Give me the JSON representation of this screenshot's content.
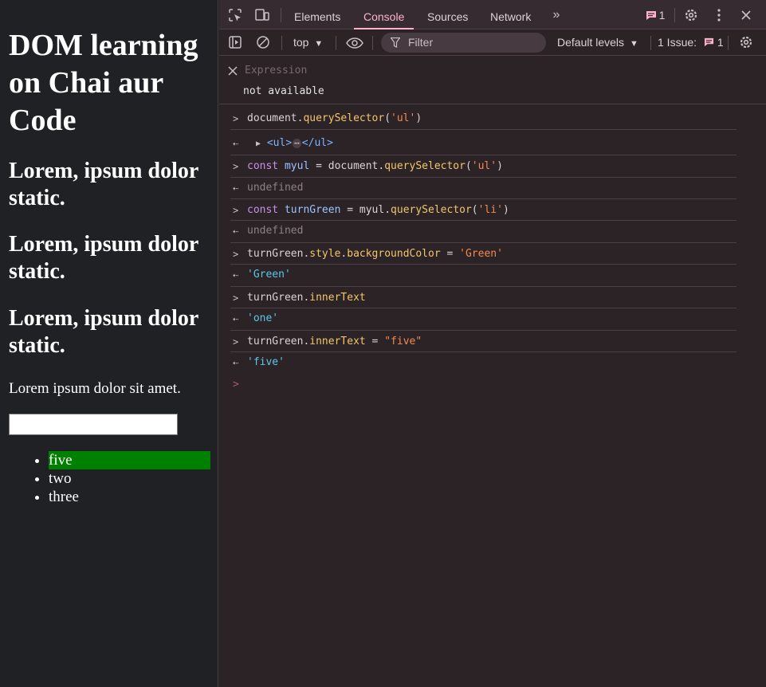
{
  "page": {
    "heading": "DOM learning on Chai aur Code",
    "subheadings": [
      "Lorem, ipsum dolor static.",
      "Lorem, ipsum dolor static.",
      "Lorem, ipsum dolor static."
    ],
    "paragraph": "Lorem ipsum dolor sit amet.",
    "list_items": [
      "five",
      "two",
      "three"
    ],
    "highlight_color": "#008000"
  },
  "devtools": {
    "tabs": [
      "Elements",
      "Console",
      "Sources",
      "Network"
    ],
    "active_tab": "Console",
    "message_count": "1",
    "context": "top",
    "filter_placeholder": "Filter",
    "levels": "Default levels",
    "issues_label": "1 Issue:",
    "issues_count": "1",
    "expression_label": "Expression",
    "expression_value": "not available",
    "accent_color": "#ffb0cb"
  },
  "console": {
    "entries": [
      {
        "input": [
          "document.",
          "querySelector",
          "(",
          "'ul'",
          ")"
        ]
      },
      {
        "output_tag_open": "<ul>",
        "output_ellipsis": "⋯",
        "output_tag_close": "</ul>"
      },
      {
        "input": [
          "const",
          " ",
          "myul",
          " = document.",
          "querySelector",
          "(",
          "'ul'",
          ")"
        ]
      },
      {
        "output": "undefined"
      },
      {
        "input": [
          "const",
          " ",
          "turnGreen",
          " = myul.",
          "querySelector",
          "(",
          "'li'",
          ")"
        ]
      },
      {
        "output": "undefined"
      },
      {
        "input": [
          "turnGreen.",
          "style",
          ".",
          "backgroundColor",
          " = ",
          "'Green'"
        ]
      },
      {
        "output": "'Green'"
      },
      {
        "input": [
          "turnGreen.",
          "innerText"
        ]
      },
      {
        "output": "'one'"
      },
      {
        "input": [
          "turnGreen.",
          "innerText",
          " = ",
          "\"five\""
        ]
      },
      {
        "output": "'five'"
      }
    ]
  }
}
